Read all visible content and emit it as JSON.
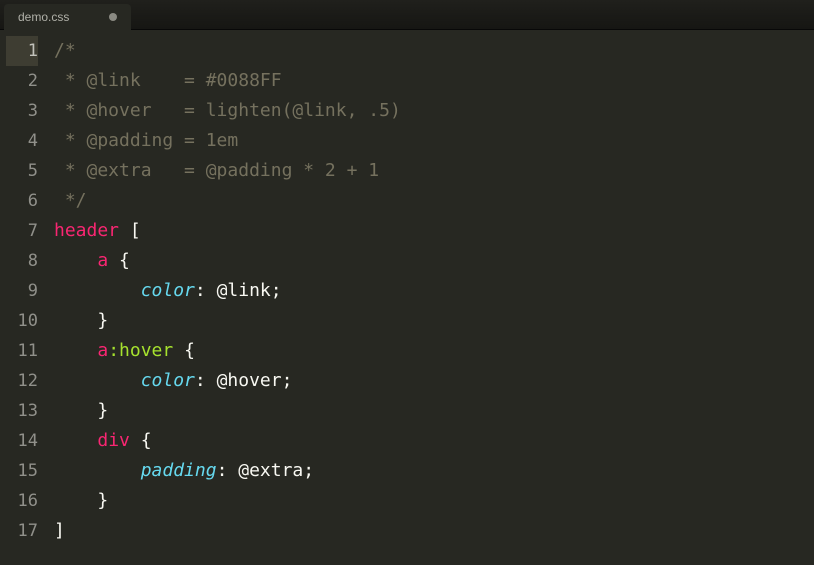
{
  "tab": {
    "filename": "demo.css",
    "dirty": true
  },
  "editor": {
    "lineCount": 17,
    "activeLine": 1,
    "lines": [
      {
        "n": 1,
        "tokens": [
          {
            "c": "comment",
            "t": "/*"
          }
        ]
      },
      {
        "n": 2,
        "tokens": [
          {
            "c": "comment",
            "t": " * @link    = #0088FF"
          }
        ]
      },
      {
        "n": 3,
        "tokens": [
          {
            "c": "comment",
            "t": " * @hover   = lighten(@link, .5)"
          }
        ]
      },
      {
        "n": 4,
        "tokens": [
          {
            "c": "comment",
            "t": " * @padding = 1em"
          }
        ]
      },
      {
        "n": 5,
        "tokens": [
          {
            "c": "comment",
            "t": " * @extra   = @padding * 2 + 1"
          }
        ]
      },
      {
        "n": 6,
        "tokens": [
          {
            "c": "comment",
            "t": " */"
          }
        ]
      },
      {
        "n": 7,
        "tokens": [
          {
            "c": "tag",
            "t": "header"
          },
          {
            "c": "punct",
            "t": " ["
          }
        ]
      },
      {
        "n": 8,
        "tokens": [
          {
            "c": "punct",
            "t": "    "
          },
          {
            "c": "tag",
            "t": "a"
          },
          {
            "c": "punct",
            "t": " {"
          }
        ]
      },
      {
        "n": 9,
        "tokens": [
          {
            "c": "punct",
            "t": "        "
          },
          {
            "c": "prop",
            "t": "color"
          },
          {
            "c": "punct",
            "t": ": "
          },
          {
            "c": "val",
            "t": "@link"
          },
          {
            "c": "punct",
            "t": ";"
          }
        ]
      },
      {
        "n": 10,
        "tokens": [
          {
            "c": "punct",
            "t": "    }"
          }
        ]
      },
      {
        "n": 11,
        "tokens": [
          {
            "c": "punct",
            "t": "    "
          },
          {
            "c": "tag",
            "t": "a"
          },
          {
            "c": "pseudo",
            "t": ":hover"
          },
          {
            "c": "punct",
            "t": " {"
          }
        ]
      },
      {
        "n": 12,
        "tokens": [
          {
            "c": "punct",
            "t": "        "
          },
          {
            "c": "prop",
            "t": "color"
          },
          {
            "c": "punct",
            "t": ": "
          },
          {
            "c": "val",
            "t": "@hover"
          },
          {
            "c": "punct",
            "t": ";"
          }
        ]
      },
      {
        "n": 13,
        "tokens": [
          {
            "c": "punct",
            "t": "    }"
          }
        ]
      },
      {
        "n": 14,
        "tokens": [
          {
            "c": "punct",
            "t": "    "
          },
          {
            "c": "tag",
            "t": "div"
          },
          {
            "c": "punct",
            "t": " {"
          }
        ]
      },
      {
        "n": 15,
        "tokens": [
          {
            "c": "punct",
            "t": "        "
          },
          {
            "c": "prop",
            "t": "padding"
          },
          {
            "c": "punct",
            "t": ": "
          },
          {
            "c": "val",
            "t": "@extra"
          },
          {
            "c": "punct",
            "t": ";"
          }
        ]
      },
      {
        "n": 16,
        "tokens": [
          {
            "c": "punct",
            "t": "    }"
          }
        ]
      },
      {
        "n": 17,
        "tokens": [
          {
            "c": "punct",
            "t": "]"
          }
        ]
      }
    ]
  }
}
